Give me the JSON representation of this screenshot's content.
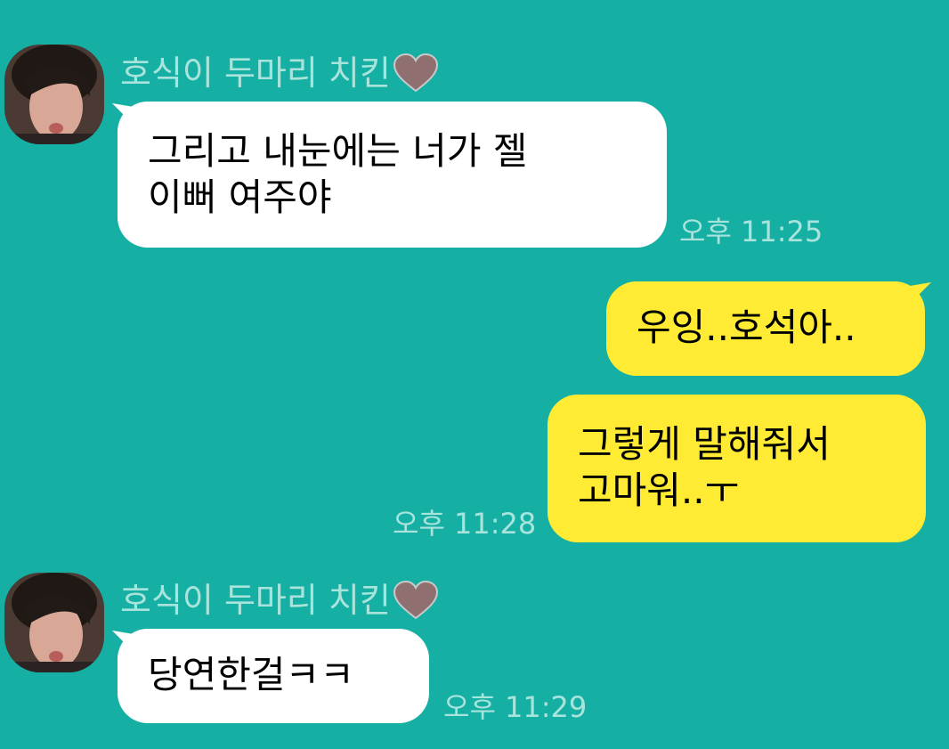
{
  "chat": {
    "messages": [
      {
        "direction": "incoming",
        "sender": "호식이 두마리 치킨",
        "lines": [
          "그리고 내눈에는 너가 젤",
          "이뻐 여주야"
        ],
        "time": "오후 11:25"
      },
      {
        "direction": "outgoing",
        "lines": [
          "우잉..호석아.."
        ],
        "time": ""
      },
      {
        "direction": "outgoing",
        "lines": [
          "그렇게 말해줘서",
          "고마워..ㅜ"
        ],
        "time": "오후 11:28"
      },
      {
        "direction": "incoming",
        "sender": "호식이 두마리 치킨",
        "lines": [
          "당연한걸ㅋㅋ"
        ],
        "time": "오후 11:29"
      }
    ]
  },
  "colors": {
    "background": "#15b0a3",
    "incoming_bubble": "#ffffff",
    "outgoing_bubble": "#ffeb33",
    "meta_text": "#a8e4dc"
  },
  "icons": {
    "avatar": "profile-photo",
    "heart": "heart-icon"
  }
}
